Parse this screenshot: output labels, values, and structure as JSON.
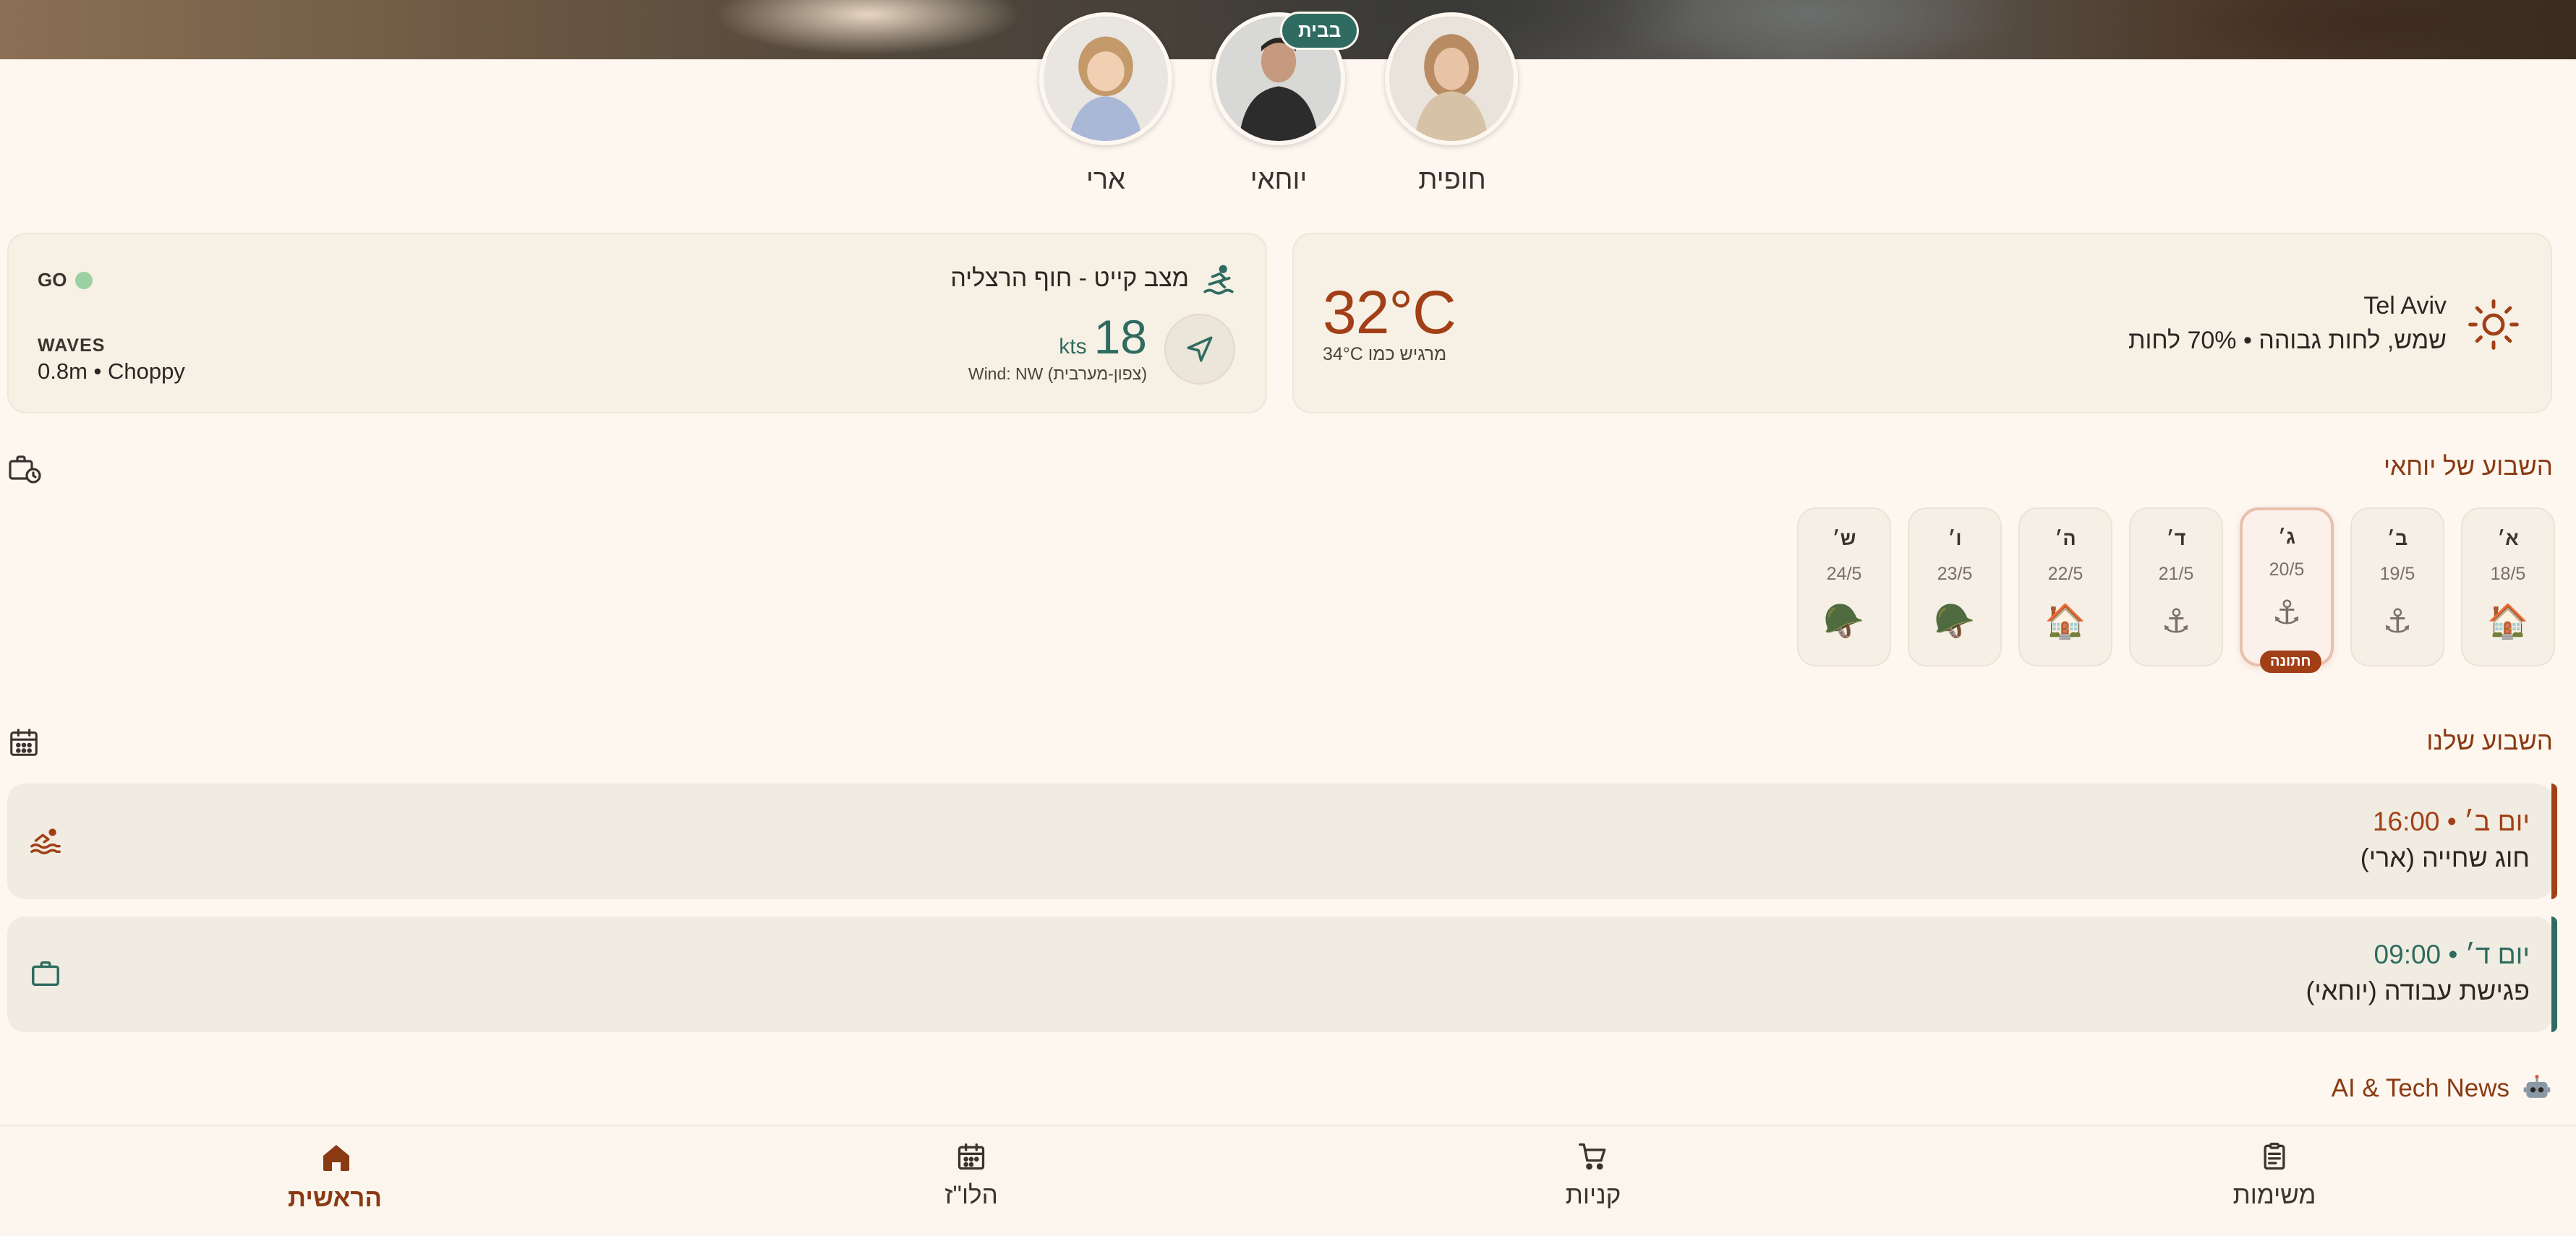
{
  "profiles": [
    {
      "name": "חופית",
      "avatar": "photo-woman"
    },
    {
      "name": "יוחאי",
      "avatar": "photo-man",
      "badge": "בבית"
    },
    {
      "name": "ארי",
      "avatar": "photo-child"
    }
  ],
  "weather": {
    "city": "Tel Aviv",
    "condition": "שמש, לחות גבוהה • 70% לחות",
    "temp": "32°C",
    "feels_like": "מרגיש כמו 34°C",
    "icon": "sun-icon"
  },
  "kite": {
    "title": "מצב קייט - חוף הרצליה",
    "icon": "surfer-icon",
    "knots": "18",
    "unit": "kts",
    "wind": "Wind: NW (צפון-מערבית)",
    "status": "GO",
    "waves_label": "WAVES",
    "waves_value": "0.8m • Choppy"
  },
  "week_person": {
    "title": "השבוע של יוחאי",
    "days": [
      {
        "name": "א׳",
        "date": "18/5",
        "icon": "🏠",
        "icon_name": "home-icon"
      },
      {
        "name": "ב׳",
        "date": "19/5",
        "icon": "⚓",
        "icon_name": "anchor-icon"
      },
      {
        "name": "ג׳",
        "date": "20/5",
        "icon": "⚓",
        "icon_name": "anchor-icon",
        "today": true,
        "badge": "חתונה"
      },
      {
        "name": "ד׳",
        "date": "21/5",
        "icon": "⚓",
        "icon_name": "anchor-icon"
      },
      {
        "name": "ה׳",
        "date": "22/5",
        "icon": "🏠",
        "icon_name": "home-icon"
      },
      {
        "name": "ו׳",
        "date": "23/5",
        "icon": "🪖",
        "icon_name": "helmet-icon"
      },
      {
        "name": "ש׳",
        "date": "24/5",
        "icon": "🪖",
        "icon_name": "helmet-icon"
      }
    ]
  },
  "week_family": {
    "title": "השבוע שלנו",
    "events": [
      {
        "time": "יום ב׳ • 16:00",
        "title": "חוג שחייה (ארי)",
        "color": "#a13f17",
        "icon": "swim-icon"
      },
      {
        "time": "יום ד׳ • 09:00",
        "title": "פגישת עבודה (יוחאי)",
        "color": "#2f6b60",
        "icon": "briefcase-icon"
      }
    ]
  },
  "news": {
    "title": "AI & Tech News",
    "icon": "robot-icon"
  },
  "nav": [
    {
      "label": "משימות",
      "icon": "clipboard-icon"
    },
    {
      "label": "קניות",
      "icon": "cart-icon"
    },
    {
      "label": "הלו\"ז",
      "icon": "calendar-icon"
    },
    {
      "label": "הראשית",
      "icon": "home-icon",
      "active": true
    }
  ],
  "colors": {
    "background": "#fdf7f0",
    "accent": "#a13f17",
    "teal": "#2f6b60",
    "card": "#f6f0e5"
  }
}
